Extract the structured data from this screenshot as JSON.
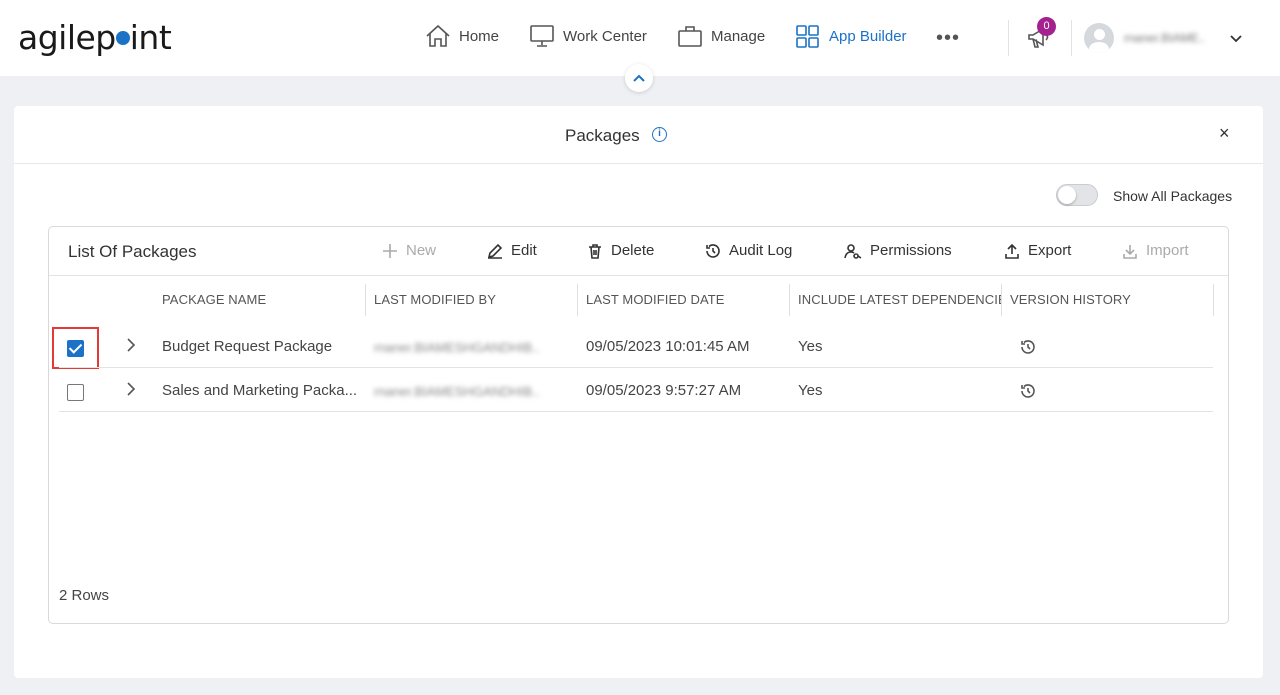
{
  "header": {
    "logo_text_a": "agilep",
    "logo_text_b": "int",
    "nav": [
      {
        "label": "Home",
        "icon": "home-icon"
      },
      {
        "label": "Work Center",
        "icon": "monitor-icon"
      },
      {
        "label": "Manage",
        "icon": "briefcase-icon"
      },
      {
        "label": "App Builder",
        "icon": "grid-icon",
        "active": true
      }
    ],
    "more_label": "•••",
    "notification_count": "0",
    "user_name": "rnaner.BIAME.."
  },
  "panel": {
    "title": "Packages",
    "close_label": "×",
    "show_all_label": "Show All Packages",
    "show_all_on": false
  },
  "list": {
    "title": "List Of Packages",
    "toolbar": {
      "new_label": "New",
      "edit_label": "Edit",
      "delete_label": "Delete",
      "audit_label": "Audit Log",
      "permissions_label": "Permissions",
      "export_label": "Export",
      "import_label": "Import"
    },
    "columns": [
      "PACKAGE NAME",
      "LAST MODIFIED BY",
      "LAST MODIFIED DATE",
      "INCLUDE LATEST DEPENDENCIES",
      "VERSION HISTORY"
    ],
    "rows": [
      {
        "checked": true,
        "name": "Budget Request Package",
        "modified_by": "rnaner.BIAMESHGANDHIB..",
        "modified_date": "09/05/2023 10:01:45 AM",
        "include_deps": "Yes"
      },
      {
        "checked": false,
        "name": "Sales and Marketing Packa...",
        "modified_by": "rnaner.BIAMESHGANDHIB..",
        "modified_date": "09/05/2023 9:57:27 AM",
        "include_deps": "Yes"
      }
    ],
    "row_count": "2 Rows"
  },
  "colors": {
    "accent": "#1b72c6",
    "badge": "#a3228f",
    "highlight": "#e53935"
  }
}
